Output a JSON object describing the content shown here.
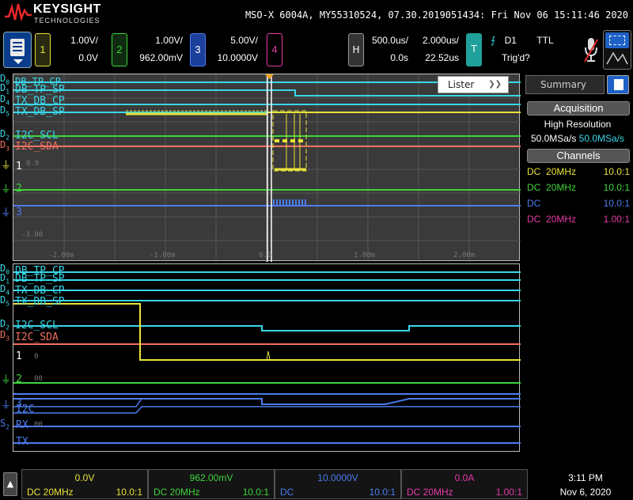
{
  "header": {
    "brand": "KEYSIGHT",
    "brand_sub": "TECHNOLOGIES",
    "instrument_info": "MSO-X 6004A, MY55310524, 07.30.2019051434: Fri Nov 06 15:11:46 2020"
  },
  "channels": [
    {
      "num": "1",
      "scale": "1.00V/",
      "offset": "0.0V",
      "color": "#e8e23a"
    },
    {
      "num": "2",
      "scale": "1.00V/",
      "offset": "962.00mV",
      "color": "#3fd43a"
    },
    {
      "num": "3",
      "scale": "5.00V/",
      "offset": "10.0000V",
      "color": "#4b7cf0"
    },
    {
      "num": "4",
      "scale": "",
      "offset": "",
      "color": "#e53aa8"
    }
  ],
  "horizontal": {
    "label": "H",
    "zoom_scale": "500.0us/",
    "zoom_delay": "0.0s",
    "main_scale": "2.000us/",
    "main_delay": "22.52us"
  },
  "trigger": {
    "label": "T",
    "source": "D1",
    "level": "TTL",
    "status": "Trig'd?"
  },
  "waveform": {
    "lister": {
      "label": "Lister"
    },
    "zoom_labels": [
      {
        "id": "D0 DB_TP_CP",
        "prefix": "D",
        "sub": "0",
        "name": "DB_TP_CP"
      },
      {
        "id": "D1 DB_TP_SP",
        "prefix": "D",
        "sub": "1",
        "name": "DB_TP_SP"
      },
      {
        "id": "D4 TX_DB_CP",
        "prefix": "D",
        "sub": "4",
        "name": "TX_DB_CP"
      },
      {
        "id": "D5 TX_DB_SP",
        "prefix": "D",
        "sub": "5",
        "name": "TX_DB_SP"
      },
      {
        "id": "D2 I2C_SCL",
        "prefix": "D",
        "sub": "2",
        "name": "I2C_SCL"
      },
      {
        "id": "D3 I2C_SDA",
        "prefix": "D",
        "sub": "3",
        "name": "I2C_SDA"
      }
    ],
    "time_ticks": [
      "-2.00m",
      "-1.00m",
      "0.0",
      "1.00m",
      "2.00m"
    ],
    "volt_ticks": {
      "zoom_ch1": "0.0",
      "zoom_ch3": "-3.00",
      "main_ch1": "0",
      "main_ch2": "00",
      "main_i2c": "00"
    },
    "ch1": "1",
    "ch2": "2",
    "ch3": "3",
    "main_bus": {
      "i2c": "I2C",
      "rx_prefix": "S",
      "rx_sub": "2",
      "rx": "RX",
      "tx": "TX"
    }
  },
  "sidebar": {
    "tab": "Summary",
    "acq_head": "Acquisition",
    "acq_mode": "High Resolution",
    "acq_rate1": "50.0MSa/s",
    "acq_rate2": "50.0MSa/s",
    "channels_head": "Channels",
    "rows": [
      {
        "coupling": "DC",
        "bw": "20MHz",
        "probe": "10.0:1",
        "color": "#e8e23a"
      },
      {
        "coupling": "DC",
        "bw": "20MHz",
        "probe": "10.0:1",
        "color": "#3fd43a"
      },
      {
        "coupling": "DC",
        "bw": "",
        "probe": "10.0:1",
        "color": "#4b7cf0"
      },
      {
        "coupling": "DC",
        "bw": "20MHz",
        "probe": "1.00:1",
        "color": "#e53aa8"
      }
    ]
  },
  "bottom": {
    "cells": [
      {
        "value": "0.0V",
        "coupling": "DC 20MHz",
        "probe": "10.0:1",
        "color": "#e8e23a"
      },
      {
        "value": "962.00mV",
        "coupling": "DC 20MHz",
        "probe": "10.0:1",
        "color": "#3fd43a"
      },
      {
        "value": "10.0000V",
        "coupling": "DC",
        "probe": "10.0:1",
        "color": "#4b7cf0"
      },
      {
        "value": "0.0A",
        "coupling": "DC 20MHz",
        "probe": "1.00:1",
        "color": "#e53aa8"
      }
    ],
    "time": "3:11 PM",
    "date": "Nov 6, 2020"
  },
  "colors": {
    "cyan": "#39d7e8",
    "green": "#3fd43a",
    "salmon": "#f07060",
    "yellow": "#e8e23a",
    "blue": "#4b7cf0",
    "teal": "#1fa09a"
  },
  "icons": [
    "menu-icon",
    "microphone-icon",
    "touch-select-icon",
    "home-icon",
    "trigger-edge-icon",
    "chevron-down-icon",
    "summary-doc-icon"
  ]
}
